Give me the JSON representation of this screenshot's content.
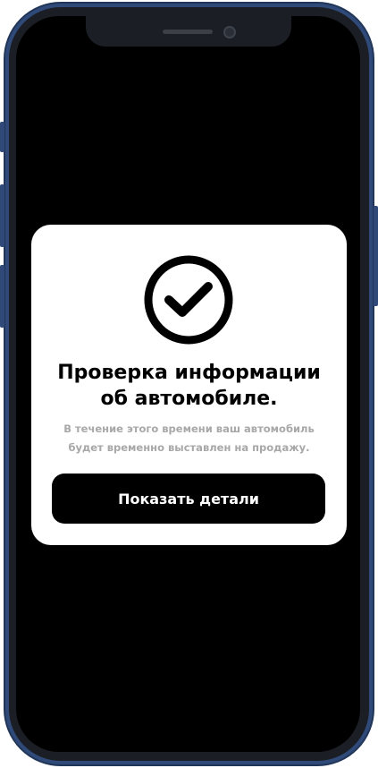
{
  "dialog": {
    "icon": "check-circle-icon",
    "title_line1": "Проверка информации",
    "title_line2": "об автомобиле.",
    "subtitle_line1": "В течение этого времени ваш автомобиль",
    "subtitle_line2": "будет временно выставлен на продажу.",
    "button_label": "Показать детали"
  },
  "colors": {
    "frame": "#2f4a78",
    "screen_background": "#000000",
    "card_background": "#ffffff",
    "title": "#000000",
    "subtitle": "#a8a8a8",
    "button_background": "#000000",
    "button_text": "#ffffff"
  }
}
